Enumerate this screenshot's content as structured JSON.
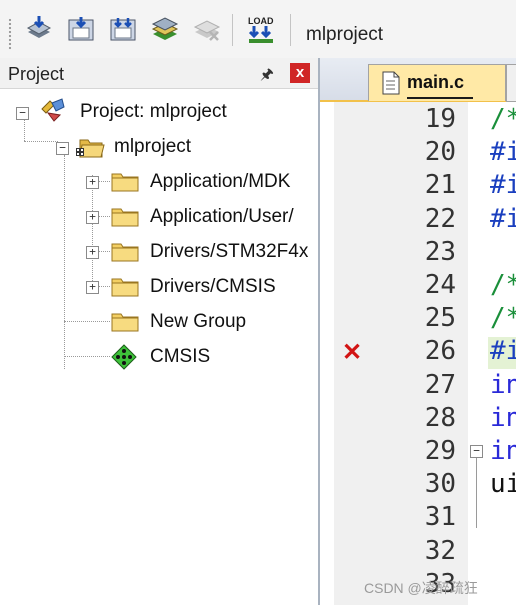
{
  "toolbar": {
    "buttons": [
      {
        "name": "download-icon"
      },
      {
        "name": "save-all-icon"
      },
      {
        "name": "batch-build-icon"
      },
      {
        "name": "stack-icon"
      },
      {
        "name": "disabled-stack-icon"
      },
      {
        "name": "load-icon",
        "text": "LOAD"
      }
    ],
    "target": "mlproject"
  },
  "project_panel": {
    "title": "Project",
    "pin": "🖈",
    "close": "x",
    "tree": {
      "root": "Project: mlproject",
      "target": "mlproject",
      "groups": [
        "Application/MDK",
        "Application/User/",
        "Drivers/STM32F4x",
        "Drivers/CMSIS",
        "New Group",
        "CMSIS"
      ]
    }
  },
  "editor": {
    "tabs": [
      {
        "label": "main.c",
        "active": true
      }
    ],
    "lines": [
      {
        "num": "19",
        "code": "/*",
        "color": "#1a8f3a"
      },
      {
        "num": "20",
        "code": "#i",
        "color": "#1a3fbf"
      },
      {
        "num": "21",
        "code": "#i",
        "color": "#1a3fbf"
      },
      {
        "num": "22",
        "code": "#i",
        "color": "#1a3fbf"
      },
      {
        "num": "23",
        "code": "",
        "color": "#000000"
      },
      {
        "num": "24",
        "code": "/*",
        "color": "#1a8f3a"
      },
      {
        "num": "25",
        "code": "/*",
        "color": "#1a8f3a"
      },
      {
        "num": "26",
        "code": "#i",
        "color": "#1a3fbf",
        "error": true
      },
      {
        "num": "27",
        "code": "in",
        "color": "#2a2ad8"
      },
      {
        "num": "28",
        "code": "in",
        "color": "#2a2ad8"
      },
      {
        "num": "29",
        "code": "in",
        "color": "#2a2ad8",
        "fold": true
      },
      {
        "num": "30",
        "code": "ui",
        "color": "#111111"
      },
      {
        "num": "31",
        "code": "",
        "color": "#000000"
      },
      {
        "num": "32",
        "code": "",
        "color": "#000000"
      },
      {
        "num": "33",
        "code": "",
        "color": "#000000"
      }
    ],
    "error_mark": "✕"
  },
  "watermark": "CSDN @凌醉疏狂"
}
